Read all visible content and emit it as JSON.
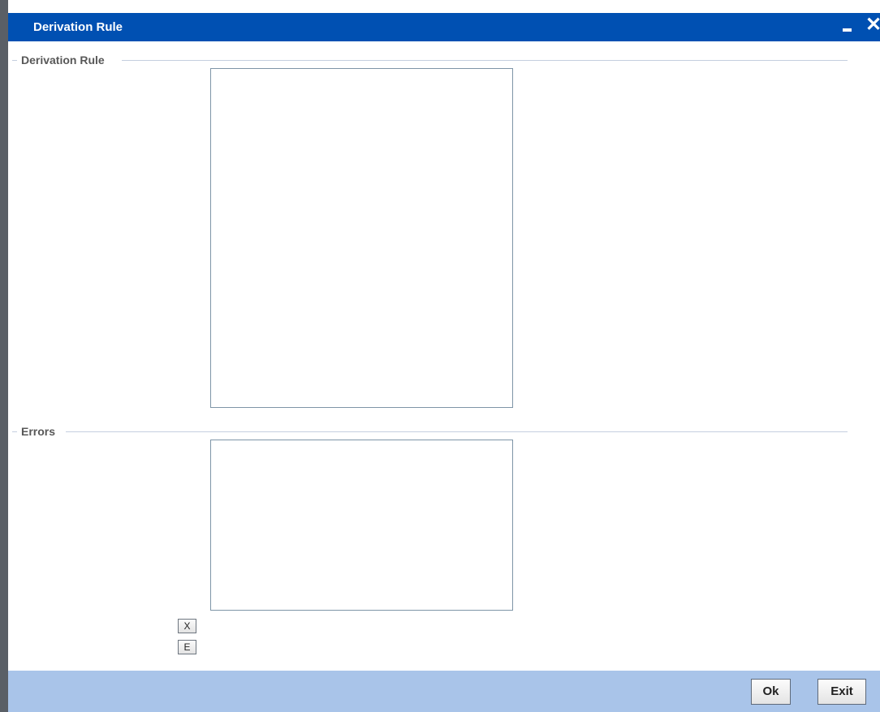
{
  "window": {
    "title": "Derivation Rule",
    "minimize_glyph": "",
    "close_glyph": "✕"
  },
  "sections": {
    "rule": {
      "legend": "Derivation Rule",
      "value": ""
    },
    "errors": {
      "legend": "Errors",
      "value": ""
    }
  },
  "error_buttons": {
    "clear_label": "X",
    "expand_label": "E"
  },
  "footer": {
    "ok_label": "Ok",
    "exit_label": "Exit"
  },
  "colors": {
    "titlebar": "#0050b2",
    "footer": "#a9c4e9",
    "section_line": "#c5cfdf"
  }
}
